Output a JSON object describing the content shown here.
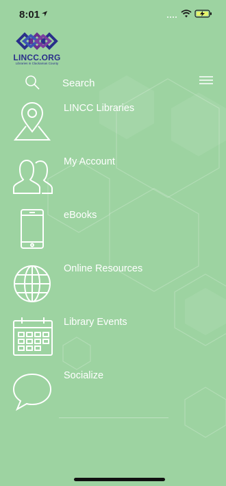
{
  "status_bar": {
    "time": "8:01"
  },
  "logo": {
    "title": "LINCC.ORG",
    "subtitle": "Libraries in Clackamas County"
  },
  "search": {
    "label": "Search"
  },
  "menu": {
    "items": [
      {
        "label": "LINCC Libraries",
        "icon": "location-pin-icon"
      },
      {
        "label": "My Account",
        "icon": "users-icon"
      },
      {
        "label": "eBooks",
        "icon": "tablet-icon"
      },
      {
        "label": "Online Resources",
        "icon": "globe-icon"
      },
      {
        "label": "Library Events",
        "icon": "calendar-icon"
      },
      {
        "label": "Socialize",
        "icon": "chat-bubble-icon"
      }
    ]
  },
  "colors": {
    "background": "#9dd3a1",
    "foreground": "#ffffff",
    "logo_blue": "#2a2f8a",
    "logo_purple": "#6a2f8f"
  }
}
